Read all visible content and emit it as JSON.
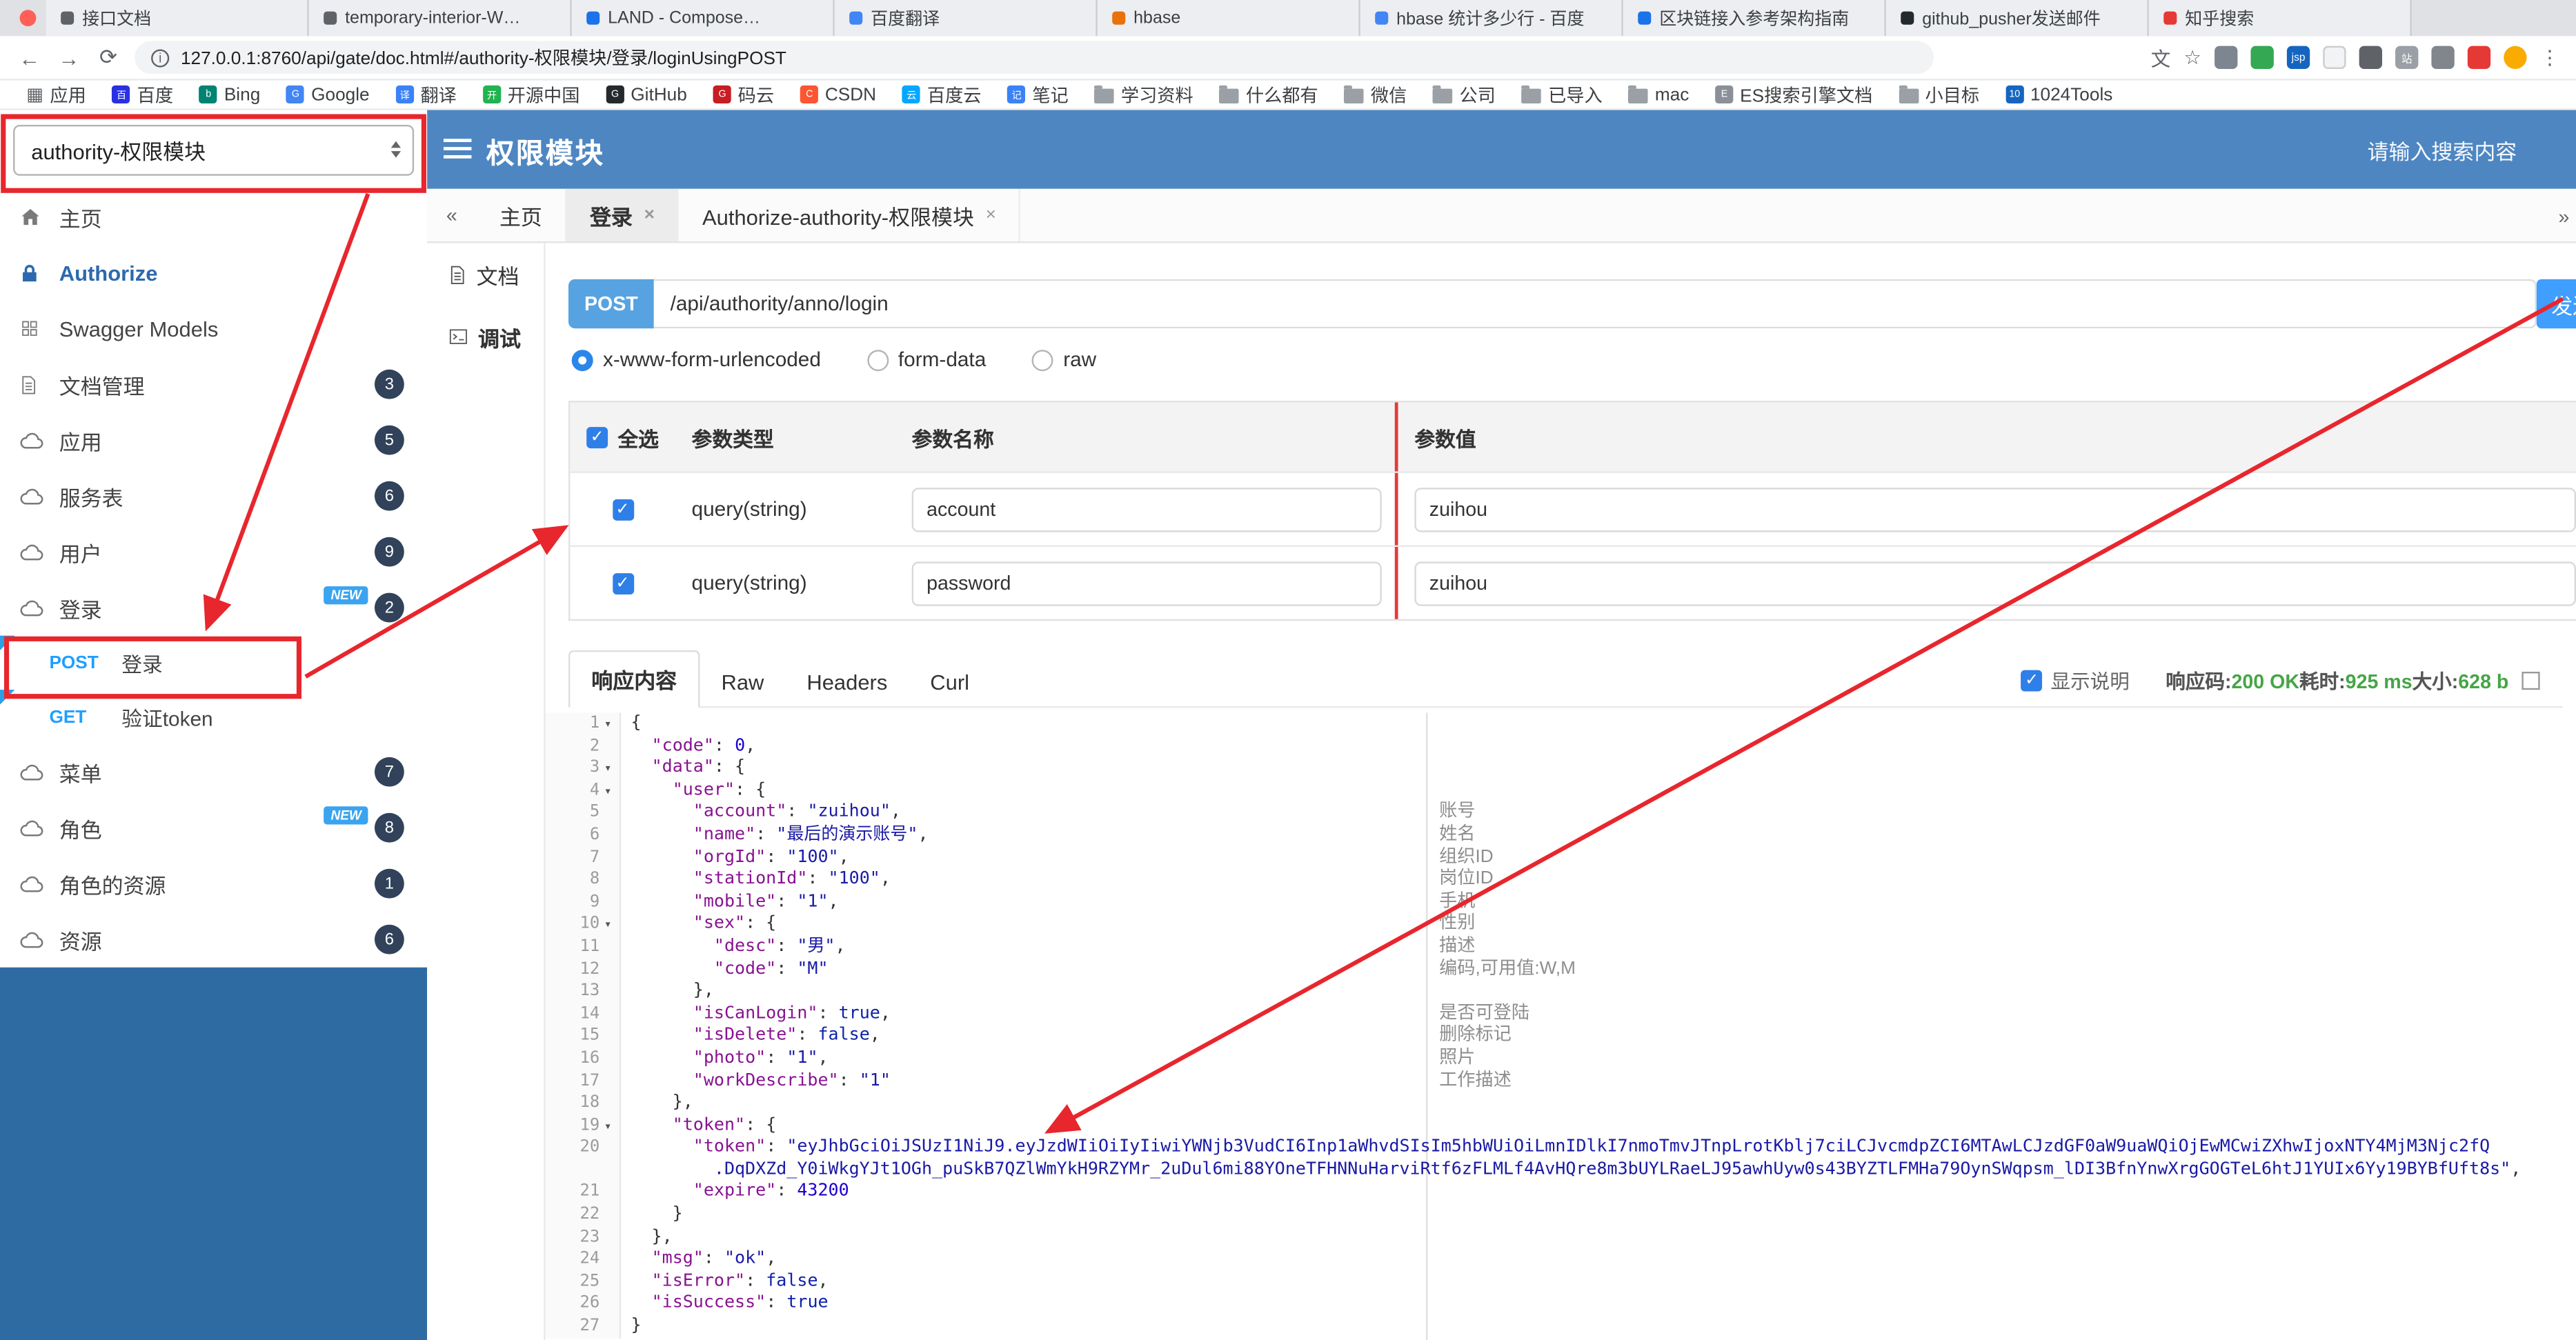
{
  "browser": {
    "tabs": [
      {
        "title": "接口文档",
        "fav": "#5f6368"
      },
      {
        "title": "temporary-interior-W…",
        "fav": "#5f6368"
      },
      {
        "title": "LAND - Compose…",
        "fav": "#1a73e8"
      },
      {
        "title": "百度翻译",
        "fav": "#4285f4"
      },
      {
        "title": "hbase",
        "fav": "#e8710a"
      },
      {
        "title": "hbase 统计多少行 - 百度",
        "fav": "#4285f4"
      },
      {
        "title": "区块链接入参考架构指南",
        "fav": "#1a73e8"
      },
      {
        "title": "github_pusher发送邮件",
        "fav": "#24292e"
      },
      {
        "title": "知乎搜索",
        "fav": "#e53935"
      }
    ],
    "url": "127.0.0.1:8760/api/gate/doc.html#/authority-权限模块/登录/loginUsingPOST",
    "toolbar_icons": [
      {
        "name": "translate-icon",
        "glyph": "文",
        "fg": "#5f6368"
      },
      {
        "name": "bookmark-star-icon",
        "glyph": "☆",
        "fg": "#5f6368"
      },
      {
        "name": "camera-extension-icon",
        "bg": "#7d8590"
      },
      {
        "name": "chrome-extension-icon",
        "bg": "#34a853"
      },
      {
        "name": "jsp-extension-icon",
        "glyph": "jsp",
        "bg": "#1565c0",
        "fg": "#fff"
      },
      {
        "name": "circle-extension-icon",
        "bg": "#f1f3f4"
      },
      {
        "name": "shield-extension-icon",
        "bg": "#5f6368"
      },
      {
        "name": "sitetool-extension-icon",
        "glyph": "站",
        "bg": "#9aa0a6",
        "fg": "#fff"
      },
      {
        "name": "puzzle-extension-icon",
        "bg": "#80868b"
      },
      {
        "name": "red-extension-icon",
        "bg": "#e53935"
      },
      {
        "name": "avatar",
        "bg": "#f9ab00"
      },
      {
        "name": "kebab-menu-icon",
        "glyph": "⋮",
        "fg": "#5f6368"
      }
    ],
    "bookmarks": [
      {
        "label": "应用",
        "icon": "apps"
      },
      {
        "label": "百度",
        "icon": "chip",
        "bg": "#2932e1",
        "glyph": "百"
      },
      {
        "label": "Bing",
        "icon": "chip",
        "bg": "#008373",
        "glyph": "b"
      },
      {
        "label": "Google",
        "icon": "chip",
        "bg": "#4285f4",
        "glyph": "G"
      },
      {
        "label": "翻译",
        "icon": "chip",
        "bg": "#3b82f6",
        "glyph": "译"
      },
      {
        "label": "开源中国",
        "icon": "chip",
        "bg": "#21b351",
        "glyph": "开"
      },
      {
        "label": "GitHub",
        "icon": "chip",
        "bg": "#24292e",
        "glyph": "G"
      },
      {
        "label": "码云",
        "icon": "chip",
        "bg": "#c71d23",
        "glyph": "G"
      },
      {
        "label": "CSDN",
        "icon": "chip",
        "bg": "#fc5531",
        "glyph": "C"
      },
      {
        "label": "百度云",
        "icon": "chip",
        "bg": "#06a7ff",
        "glyph": "云"
      },
      {
        "label": "笔记",
        "icon": "chip",
        "bg": "#3b82f6",
        "glyph": "记"
      },
      {
        "label": "学习资料",
        "icon": "folder"
      },
      {
        "label": "什么都有",
        "icon": "folder"
      },
      {
        "label": "微信",
        "icon": "folder"
      },
      {
        "label": "公司",
        "icon": "folder"
      },
      {
        "label": "已导入",
        "icon": "folder"
      },
      {
        "label": "mac",
        "icon": "folder"
      },
      {
        "label": "ES搜索引擎文档",
        "icon": "chip",
        "bg": "#8a8f98",
        "glyph": "E"
      },
      {
        "label": "小目标",
        "icon": "folder"
      },
      {
        "label": "1024Tools",
        "icon": "chip",
        "bg": "#1565c0",
        "glyph": "10"
      }
    ]
  },
  "header": {
    "module_select": "authority-权限模块",
    "title": "权限模块",
    "search_placeholder": "请输入搜索内容"
  },
  "sidebar": {
    "new_label": "NEW",
    "items": [
      {
        "label": "主页",
        "icon": "home"
      },
      {
        "label": "Authorize",
        "icon": "lock",
        "auth": true
      },
      {
        "label": "Swagger Models",
        "icon": "models"
      },
      {
        "label": "文档管理",
        "icon": "doc",
        "badge": "3"
      },
      {
        "label": "应用",
        "icon": "cloud",
        "badge": "5"
      },
      {
        "label": "服务表",
        "icon": "cloud",
        "badge": "6"
      },
      {
        "label": "用户",
        "icon": "cloud",
        "badge": "9"
      },
      {
        "label": "登录",
        "icon": "cloud",
        "badge": "2",
        "new": true
      },
      {
        "type": "sub",
        "method": "POST",
        "label": "登录",
        "flag": true
      },
      {
        "type": "sub",
        "method": "GET",
        "label": "验证token",
        "flag": true
      },
      {
        "label": "菜单",
        "icon": "cloud",
        "badge": "7"
      },
      {
        "label": "角色",
        "icon": "cloud",
        "badge": "8",
        "new": true
      },
      {
        "label": "角色的资源",
        "icon": "cloud",
        "badge": "1"
      },
      {
        "label": "资源",
        "icon": "cloud",
        "badge": "6"
      }
    ]
  },
  "tabs": {
    "back": "«",
    "forward": "»",
    "items": [
      {
        "label": "主页",
        "closable": false
      },
      {
        "label": "登录",
        "closable": true,
        "active": true
      },
      {
        "label": "Authorize-authority-权限模块",
        "closable": true
      }
    ]
  },
  "doc_nav": [
    {
      "label": "文档",
      "icon": "doc"
    },
    {
      "label": "调试",
      "icon": "debug",
      "active": true
    }
  ],
  "request": {
    "method": "POST",
    "path": "/api/authority/anno/login",
    "send_label": "发送",
    "content_types": [
      {
        "label": "x-www-form-urlencoded",
        "selected": true
      },
      {
        "label": "form-data",
        "selected": false
      },
      {
        "label": "raw",
        "selected": false
      }
    ]
  },
  "params": {
    "select_all": "全选",
    "headers": [
      "参数类型",
      "参数名称",
      "参数值"
    ],
    "rows": [
      {
        "checked": true,
        "type": "query(string)",
        "name": "account",
        "value": "zuihou"
      },
      {
        "checked": true,
        "type": "query(string)",
        "name": "password",
        "value": "zuihou"
      }
    ]
  },
  "response": {
    "tabs": [
      {
        "label": "响应内容",
        "active": true
      },
      {
        "label": "Raw",
        "active": false
      },
      {
        "label": "Headers",
        "active": false
      },
      {
        "label": "Curl",
        "active": false
      }
    ],
    "show_desc_label": "显示说明",
    "show_desc_checked": true,
    "meta": [
      {
        "label": "响应码:",
        "value": "200 OK"
      },
      {
        "label": "耗时:",
        "value": "925 ms"
      },
      {
        "label": "大小:",
        "value": "628 b"
      }
    ]
  },
  "json_viewer": {
    "lines": [
      {
        "n": 1,
        "fold": true,
        "seg": [
          {
            "t": "{",
            "c": "p"
          }
        ]
      },
      {
        "n": 2,
        "seg": [
          {
            "t": "  ",
            "c": "p"
          },
          {
            "t": "\"code\"",
            "c": "k"
          },
          {
            "t": ": ",
            "c": "p"
          },
          {
            "t": "0",
            "c": "n"
          },
          {
            "t": ",",
            "c": "p"
          }
        ]
      },
      {
        "n": 3,
        "fold": true,
        "seg": [
          {
            "t": "  ",
            "c": "p"
          },
          {
            "t": "\"data\"",
            "c": "k"
          },
          {
            "t": ": {",
            "c": "p"
          }
        ]
      },
      {
        "n": 4,
        "fold": true,
        "seg": [
          {
            "t": "    ",
            "c": "p"
          },
          {
            "t": "\"user\"",
            "c": "k"
          },
          {
            "t": ": {",
            "c": "p"
          }
        ]
      },
      {
        "n": 5,
        "seg": [
          {
            "t": "      ",
            "c": "p"
          },
          {
            "t": "\"account\"",
            "c": "k"
          },
          {
            "t": ": ",
            "c": "p"
          },
          {
            "t": "\"zuihou\"",
            "c": "s"
          },
          {
            "t": ",",
            "c": "p"
          }
        ]
      },
      {
        "n": 6,
        "seg": [
          {
            "t": "      ",
            "c": "p"
          },
          {
            "t": "\"name\"",
            "c": "k"
          },
          {
            "t": ": ",
            "c": "p"
          },
          {
            "t": "\"最后的演示账号\"",
            "c": "s"
          },
          {
            "t": ",",
            "c": "p"
          }
        ]
      },
      {
        "n": 7,
        "seg": [
          {
            "t": "      ",
            "c": "p"
          },
          {
            "t": "\"orgId\"",
            "c": "k"
          },
          {
            "t": ": ",
            "c": "p"
          },
          {
            "t": "\"100\"",
            "c": "s"
          },
          {
            "t": ",",
            "c": "p"
          }
        ]
      },
      {
        "n": 8,
        "seg": [
          {
            "t": "      ",
            "c": "p"
          },
          {
            "t": "\"stationId\"",
            "c": "k"
          },
          {
            "t": ": ",
            "c": "p"
          },
          {
            "t": "\"100\"",
            "c": "s"
          },
          {
            "t": ",",
            "c": "p"
          }
        ]
      },
      {
        "n": 9,
        "seg": [
          {
            "t": "      ",
            "c": "p"
          },
          {
            "t": "\"mobile\"",
            "c": "k"
          },
          {
            "t": ": ",
            "c": "p"
          },
          {
            "t": "\"1\"",
            "c": "s"
          },
          {
            "t": ",",
            "c": "p"
          }
        ]
      },
      {
        "n": 10,
        "fold": true,
        "seg": [
          {
            "t": "      ",
            "c": "p"
          },
          {
            "t": "\"sex\"",
            "c": "k"
          },
          {
            "t": ": {",
            "c": "p"
          }
        ]
      },
      {
        "n": 11,
        "seg": [
          {
            "t": "        ",
            "c": "p"
          },
          {
            "t": "\"desc\"",
            "c": "k"
          },
          {
            "t": ": ",
            "c": "p"
          },
          {
            "t": "\"男\"",
            "c": "s"
          },
          {
            "t": ",",
            "c": "p"
          }
        ]
      },
      {
        "n": 12,
        "seg": [
          {
            "t": "        ",
            "c": "p"
          },
          {
            "t": "\"code\"",
            "c": "k"
          },
          {
            "t": ": ",
            "c": "p"
          },
          {
            "t": "\"M\"",
            "c": "s"
          }
        ]
      },
      {
        "n": 13,
        "seg": [
          {
            "t": "      },",
            "c": "p"
          }
        ]
      },
      {
        "n": 14,
        "seg": [
          {
            "t": "      ",
            "c": "p"
          },
          {
            "t": "\"isCanLogin\"",
            "c": "k"
          },
          {
            "t": ": ",
            "c": "p"
          },
          {
            "t": "true",
            "c": "b"
          },
          {
            "t": ",",
            "c": "p"
          }
        ]
      },
      {
        "n": 15,
        "seg": [
          {
            "t": "      ",
            "c": "p"
          },
          {
            "t": "\"isDelete\"",
            "c": "k"
          },
          {
            "t": ": ",
            "c": "p"
          },
          {
            "t": "false",
            "c": "b"
          },
          {
            "t": ",",
            "c": "p"
          }
        ]
      },
      {
        "n": 16,
        "seg": [
          {
            "t": "      ",
            "c": "p"
          },
          {
            "t": "\"photo\"",
            "c": "k"
          },
          {
            "t": ": ",
            "c": "p"
          },
          {
            "t": "\"1\"",
            "c": "s"
          },
          {
            "t": ",",
            "c": "p"
          }
        ]
      },
      {
        "n": 17,
        "seg": [
          {
            "t": "      ",
            "c": "p"
          },
          {
            "t": "\"workDescribe\"",
            "c": "k"
          },
          {
            "t": ": ",
            "c": "p"
          },
          {
            "t": "\"1\"",
            "c": "s"
          }
        ]
      },
      {
        "n": 18,
        "seg": [
          {
            "t": "    },",
            "c": "p"
          }
        ]
      },
      {
        "n": 19,
        "fold": true,
        "seg": [
          {
            "t": "    ",
            "c": "p"
          },
          {
            "t": "\"token\"",
            "c": "k"
          },
          {
            "t": ": {",
            "c": "p"
          }
        ]
      },
      {
        "n": 20,
        "seg": [
          {
            "t": "      ",
            "c": "p"
          },
          {
            "t": "\"token\"",
            "c": "k"
          },
          {
            "t": ": ",
            "c": "p"
          },
          {
            "t": "\"eyJhbGciOiJSUzI1NiJ9.eyJzdWIiOiIyIiwiYWNjb3VudCI6Inp1aWhvdSIsIm5hbWUiOiLmnIDlkI7nmoTmvJTnpLrotKblj7ciLCJvcmdpZCI6MTAwLCJzdGF0aW9uaWQiOjEwMCwiZXhwIjoxNTY4MjM3Njc2fQ",
            "c": "s"
          }
        ]
      },
      {
        "seg": [
          {
            "t": "        ",
            "c": "p"
          },
          {
            "t": ".DqDXZd_Y0iWkgYJt1OGh_puSkB7QZlWmYkH9RZYMr_2uDul6mi88YOneTFHNNuHarviRtf6zFLMLf4AvHQre8m3bUYLRaeLJ95awhUyw0s43BYZTLFMHa79OynSWqpsm_lDI3BfnYnwXrgGOGTeL6htJ1YUIx6Yy19BYBfUft8s\"",
            "c": "s"
          },
          {
            "t": ",",
            "c": "p"
          }
        ]
      },
      {
        "n": 21,
        "seg": [
          {
            "t": "      ",
            "c": "p"
          },
          {
            "t": "\"expire\"",
            "c": "k"
          },
          {
            "t": ": ",
            "c": "p"
          },
          {
            "t": "43200",
            "c": "n"
          }
        ]
      },
      {
        "n": 22,
        "seg": [
          {
            "t": "    }",
            "c": "p"
          }
        ]
      },
      {
        "n": 23,
        "seg": [
          {
            "t": "  },",
            "c": "p"
          }
        ]
      },
      {
        "n": 24,
        "seg": [
          {
            "t": "  ",
            "c": "p"
          },
          {
            "t": "\"msg\"",
            "c": "k"
          },
          {
            "t": ": ",
            "c": "p"
          },
          {
            "t": "\"ok\"",
            "c": "s"
          },
          {
            "t": ",",
            "c": "p"
          }
        ]
      },
      {
        "n": 25,
        "seg": [
          {
            "t": "  ",
            "c": "p"
          },
          {
            "t": "\"isError\"",
            "c": "k"
          },
          {
            "t": ": ",
            "c": "p"
          },
          {
            "t": "false",
            "c": "b"
          },
          {
            "t": ",",
            "c": "p"
          }
        ]
      },
      {
        "n": 26,
        "seg": [
          {
            "t": "  ",
            "c": "p"
          },
          {
            "t": "\"isSuccess\"",
            "c": "k"
          },
          {
            "t": ": ",
            "c": "p"
          },
          {
            "t": "true",
            "c": "b"
          }
        ]
      },
      {
        "n": 27,
        "seg": [
          {
            "t": "}",
            "c": "p"
          }
        ]
      }
    ],
    "annotations": [
      {
        "line": 5,
        "text": "账号"
      },
      {
        "line": 6,
        "text": "姓名"
      },
      {
        "line": 7,
        "text": "组织ID"
      },
      {
        "line": 8,
        "text": "岗位ID"
      },
      {
        "line": 9,
        "text": "手机"
      },
      {
        "line": 10,
        "text": "性别"
      },
      {
        "line": 11,
        "text": "描述"
      },
      {
        "line": 12,
        "text": "编码,可用值:W,M"
      },
      {
        "line": 14,
        "text": "是否可登陆"
      },
      {
        "line": 15,
        "text": "删除标记"
      },
      {
        "line": 16,
        "text": "照片"
      },
      {
        "line": 17,
        "text": "工作描述"
      }
    ]
  }
}
